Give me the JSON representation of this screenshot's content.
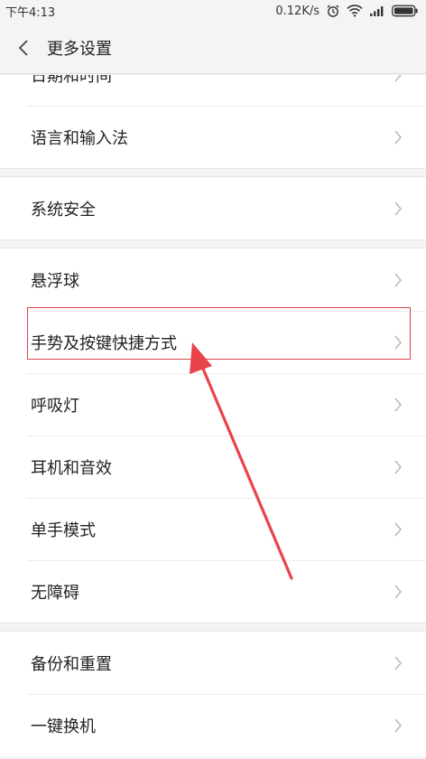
{
  "status_bar": {
    "time": "下午4:13",
    "network_speed": "0.12K/s",
    "icons": [
      "alarm-icon",
      "wifi-icon",
      "signal-icon",
      "battery-icon"
    ]
  },
  "header": {
    "title": "更多设置",
    "back_icon": "chevron-left-icon"
  },
  "groups": [
    {
      "items": [
        {
          "label": "日期和时间",
          "partially_visible": true
        },
        {
          "label": "语言和输入法"
        }
      ]
    },
    {
      "items": [
        {
          "label": "系统安全"
        }
      ]
    },
    {
      "items": [
        {
          "label": "悬浮球"
        },
        {
          "label": "手势及按键快捷方式",
          "highlighted": true
        },
        {
          "label": "呼吸灯"
        },
        {
          "label": "耳机和音效"
        },
        {
          "label": "单手模式"
        },
        {
          "label": "无障碍"
        }
      ]
    },
    {
      "items": [
        {
          "label": "备份和重置"
        },
        {
          "label": "一键换机"
        }
      ]
    }
  ],
  "annotation": {
    "type": "red-box-and-arrow",
    "color": "#e8434a"
  },
  "colors": {
    "background": "#f4f4f4",
    "card": "#ffffff",
    "text": "#222222",
    "chevron": "#b8b8b8",
    "annotation": "#e8434a"
  }
}
